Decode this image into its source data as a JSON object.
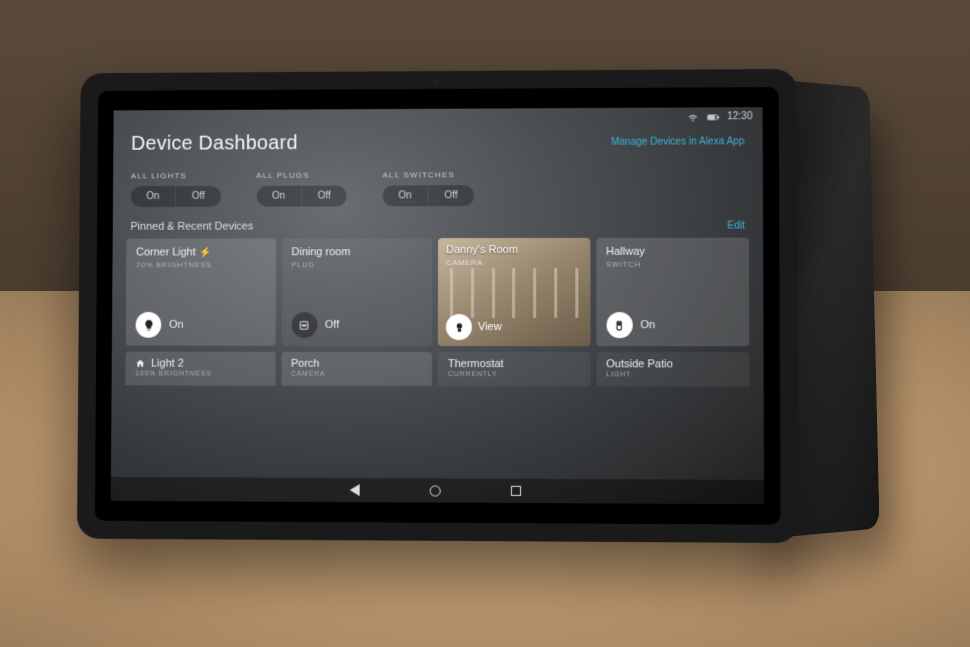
{
  "status": {
    "time": "12:30"
  },
  "header": {
    "title": "Device Dashboard",
    "manage_link": "Manage Devices in Alexa App"
  },
  "quick": [
    {
      "label": "ALL LIGHTS",
      "on": "On",
      "off": "Off"
    },
    {
      "label": "ALL PLUGS",
      "on": "On",
      "off": "Off"
    },
    {
      "label": "ALL SWITCHES",
      "on": "On",
      "off": "Off"
    }
  ],
  "section": {
    "title": "Pinned & Recent Devices",
    "edit": "Edit"
  },
  "cards": [
    {
      "title": "Corner Light",
      "sub": "70% BRIGHTNESS",
      "state": "On",
      "bolt": true,
      "icon": "bulb",
      "active": true
    },
    {
      "title": "Dining room",
      "sub": "PLUG",
      "state": "Off",
      "icon": "plug",
      "active": false
    },
    {
      "title": "Danny's Room",
      "sub": "CAMERA",
      "state": "View",
      "icon": "camera",
      "camera": true
    },
    {
      "title": "Hallway",
      "sub": "SWITCH",
      "state": "On",
      "icon": "switch",
      "active": true
    }
  ],
  "cards2": [
    {
      "title": "Light 2",
      "sub": "100% BRIGHTNESS",
      "has_home_icon": true
    },
    {
      "title": "Porch",
      "sub": "CAMERA"
    },
    {
      "title": "Thermostat",
      "sub": "CURRENTLY"
    },
    {
      "title": "Outside Patio",
      "sub": "Light"
    }
  ]
}
